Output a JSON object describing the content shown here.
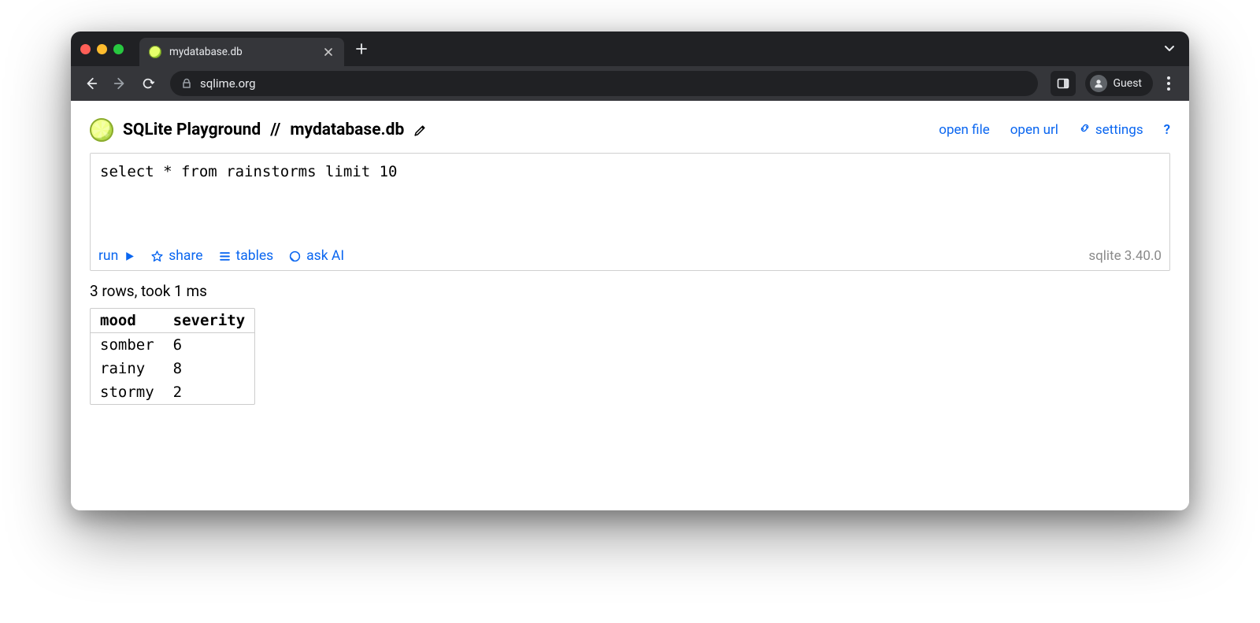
{
  "browser": {
    "tab_title": "mydatabase.db",
    "url": "sqlime.org",
    "profile_label": "Guest"
  },
  "header": {
    "app_title": "SQLite Playground",
    "separator": "//",
    "db_name": "mydatabase.db",
    "links": {
      "open_file": "open file",
      "open_url": "open url",
      "settings": "settings",
      "help": "?"
    }
  },
  "editor": {
    "sql": "select * from rainstorms limit 10",
    "actions": {
      "run": "run",
      "share": "share",
      "tables": "tables",
      "ask_ai": "ask AI"
    },
    "version_label": "sqlite 3.40.0"
  },
  "status": "3 rows, took 1 ms",
  "results": {
    "columns": [
      "mood",
      "severity"
    ],
    "rows": [
      [
        "somber",
        "6"
      ],
      [
        "rainy",
        "8"
      ],
      [
        "stormy",
        "2"
      ]
    ]
  }
}
